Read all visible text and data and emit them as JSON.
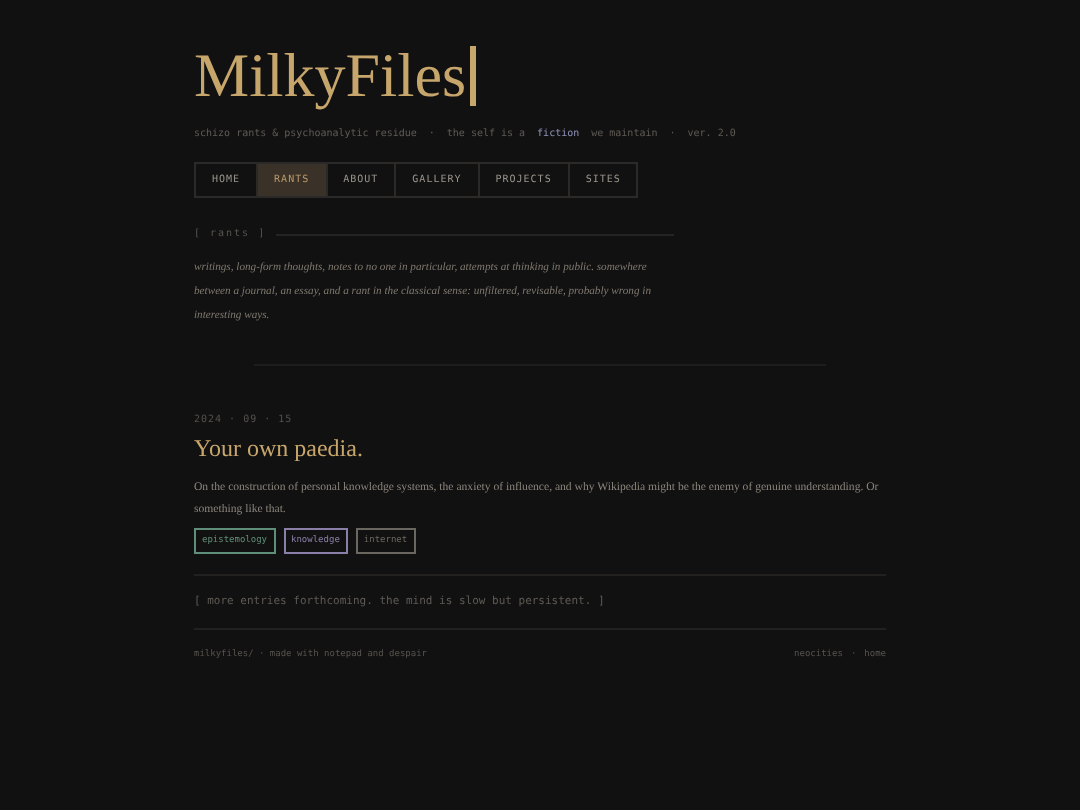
{
  "site": {
    "title": "MilkyFiles",
    "tagline": [
      {
        "text": "schizo rants & psychoanalytic residue",
        "emph": false
      },
      {
        "text": "·",
        "emph": false
      },
      {
        "text": "the self is a ",
        "emph": false
      },
      {
        "text": "fiction",
        "emph": true
      },
      {
        "text": " we maintain",
        "emph": false
      },
      {
        "text": "·",
        "emph": false
      },
      {
        "text": "ver. 2.0",
        "emph": false
      }
    ]
  },
  "nav": [
    {
      "label": "HOME",
      "selected": false
    },
    {
      "label": "RANTS",
      "selected": true
    },
    {
      "label": "ABOUT",
      "selected": false
    },
    {
      "label": "GALLERY",
      "selected": false
    },
    {
      "label": "PROJECTS",
      "selected": false
    },
    {
      "label": "SITES",
      "selected": false
    }
  ],
  "section": {
    "label": "[ rants ]",
    "description": "writings, long-form thoughts, notes to no one in particular, attempts at thinking in public. somewhere between a journal, an essay, and a rant in the classical sense: unfiltered, revisable, probably wrong in interesting ways."
  },
  "posts": [
    {
      "date": "2024 · 09 · 15",
      "title": "Your own paedia.",
      "summary": "On the construction of personal knowledge systems, the anxiety of influence, and why Wikipedia might be the enemy of genuine understanding. Or something like that.",
      "tags": [
        {
          "label": "epistemology",
          "color": "#5f8f7a"
        },
        {
          "label": "knowledge",
          "color": "#8a7fa8"
        },
        {
          "label": "internet",
          "color": "#6a6660"
        }
      ]
    }
  ],
  "notice": "[ more entries forthcoming. the mind is slow but persistent. ]",
  "footer": {
    "left": "milkyfiles/ · made with notepad and despair",
    "links": [
      "neocities",
      "·",
      "home"
    ]
  }
}
